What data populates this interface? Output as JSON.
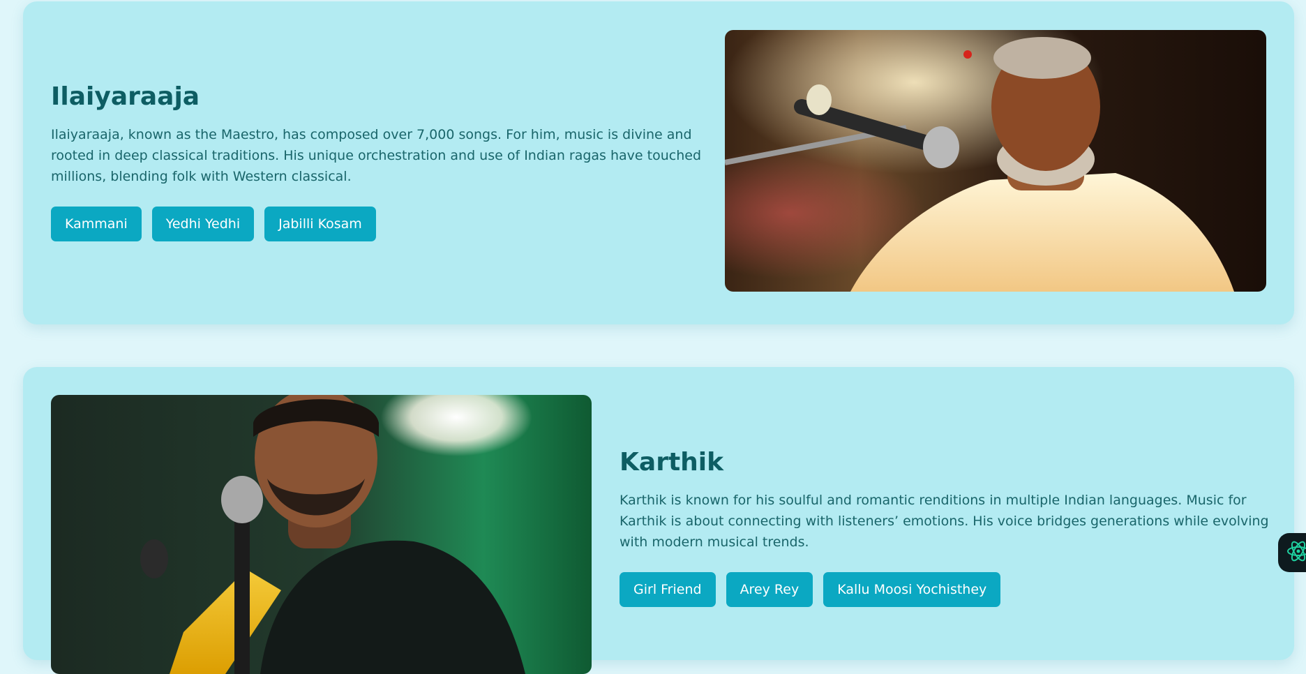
{
  "artists": [
    {
      "name": "Ilaiyaraaja",
      "description": "Ilaiyaraaja, known as the Maestro, has composed over 7,000 songs. For him, music is divine and rooted in deep classical traditions. His unique orchestration and use of Indian ragas have touched millions, blending folk with Western classical.",
      "songs": [
        "Kammani",
        "Yedhi Yedhi",
        "Jabilli Kosam"
      ],
      "photo_icon": "ilaiyaraaja-photo"
    },
    {
      "name": "Karthik",
      "description": "Karthik is known for his soulful and romantic renditions in multiple Indian languages. Music for Karthik is about connecting with listeners’ emotions. His voice bridges generations while evolving with modern musical trends.",
      "songs": [
        "Girl Friend",
        "Arey Rey",
        "Kallu Moosi Yochisthey"
      ],
      "photo_icon": "karthik-photo"
    }
  ],
  "widget": {
    "icon": "atom-icon"
  },
  "colors": {
    "page_background": "#dff6fa",
    "card_background": "#b3ebf2",
    "heading": "#0d5d63",
    "body_text": "#19656a",
    "chip_background": "#0ba8c2",
    "chip_text": "#ffffff"
  }
}
